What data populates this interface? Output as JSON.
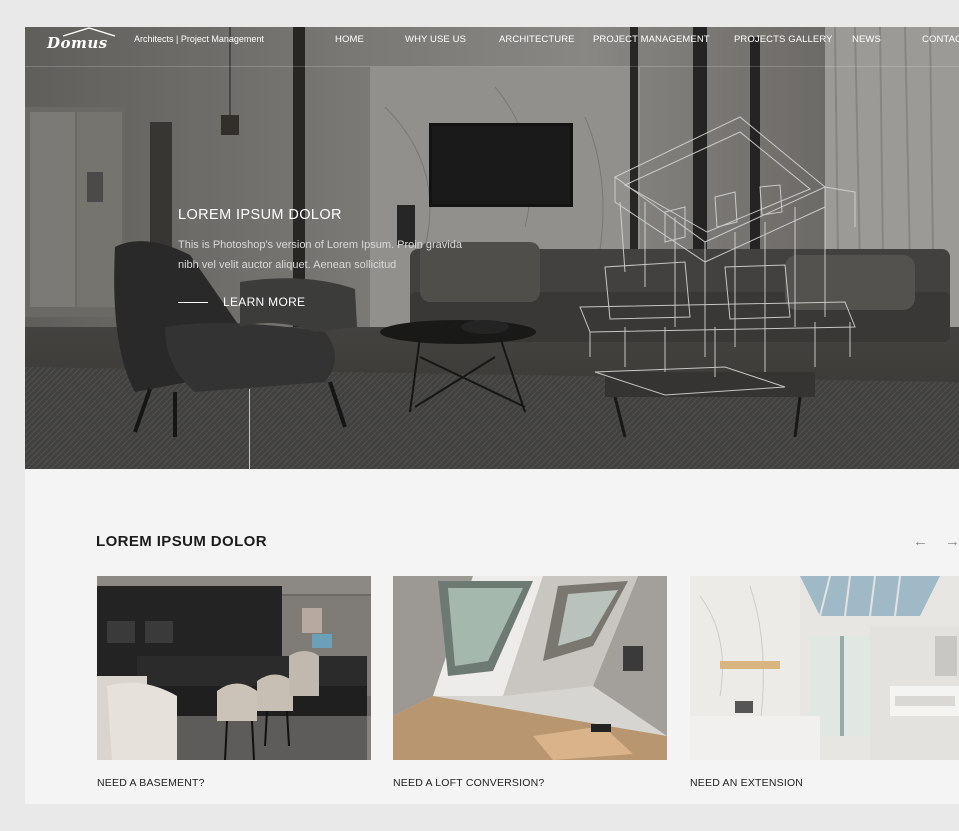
{
  "brand": {
    "logo": "Domus",
    "tagline": "Architects | Project Management"
  },
  "nav": [
    "HOME",
    "WHY USE US",
    "ARCHITECTURE",
    "PROJECT MANAGEMENT",
    "PROJECTS GALLERY",
    "NEWS",
    "CONTACT"
  ],
  "hero": {
    "title": "LOREM IPSUM DOLOR",
    "text": "This is Photoshop's version  of Lorem Ipsum. Proin gravida nibh vel velit auctor aliquet. Aenean sollicitud",
    "cta": "LEARN MORE"
  },
  "section": {
    "title": "LOREM IPSUM DOLOR",
    "prev_icon": "arrow-left-icon",
    "next_icon": "arrow-right-icon",
    "prev_glyph": "←",
    "next_glyph": "→",
    "cards": [
      {
        "caption": "NEED A BASEMENT?"
      },
      {
        "caption": "NEED A LOFT CONVERSION?"
      },
      {
        "caption": "NEED AN EXTENSION"
      }
    ]
  },
  "colors": {
    "page_bg": "#e9e9e9",
    "panel_bg": "#f4f4f4",
    "text_dark": "#1c1c1c",
    "hero_text": "#ffffff"
  }
}
